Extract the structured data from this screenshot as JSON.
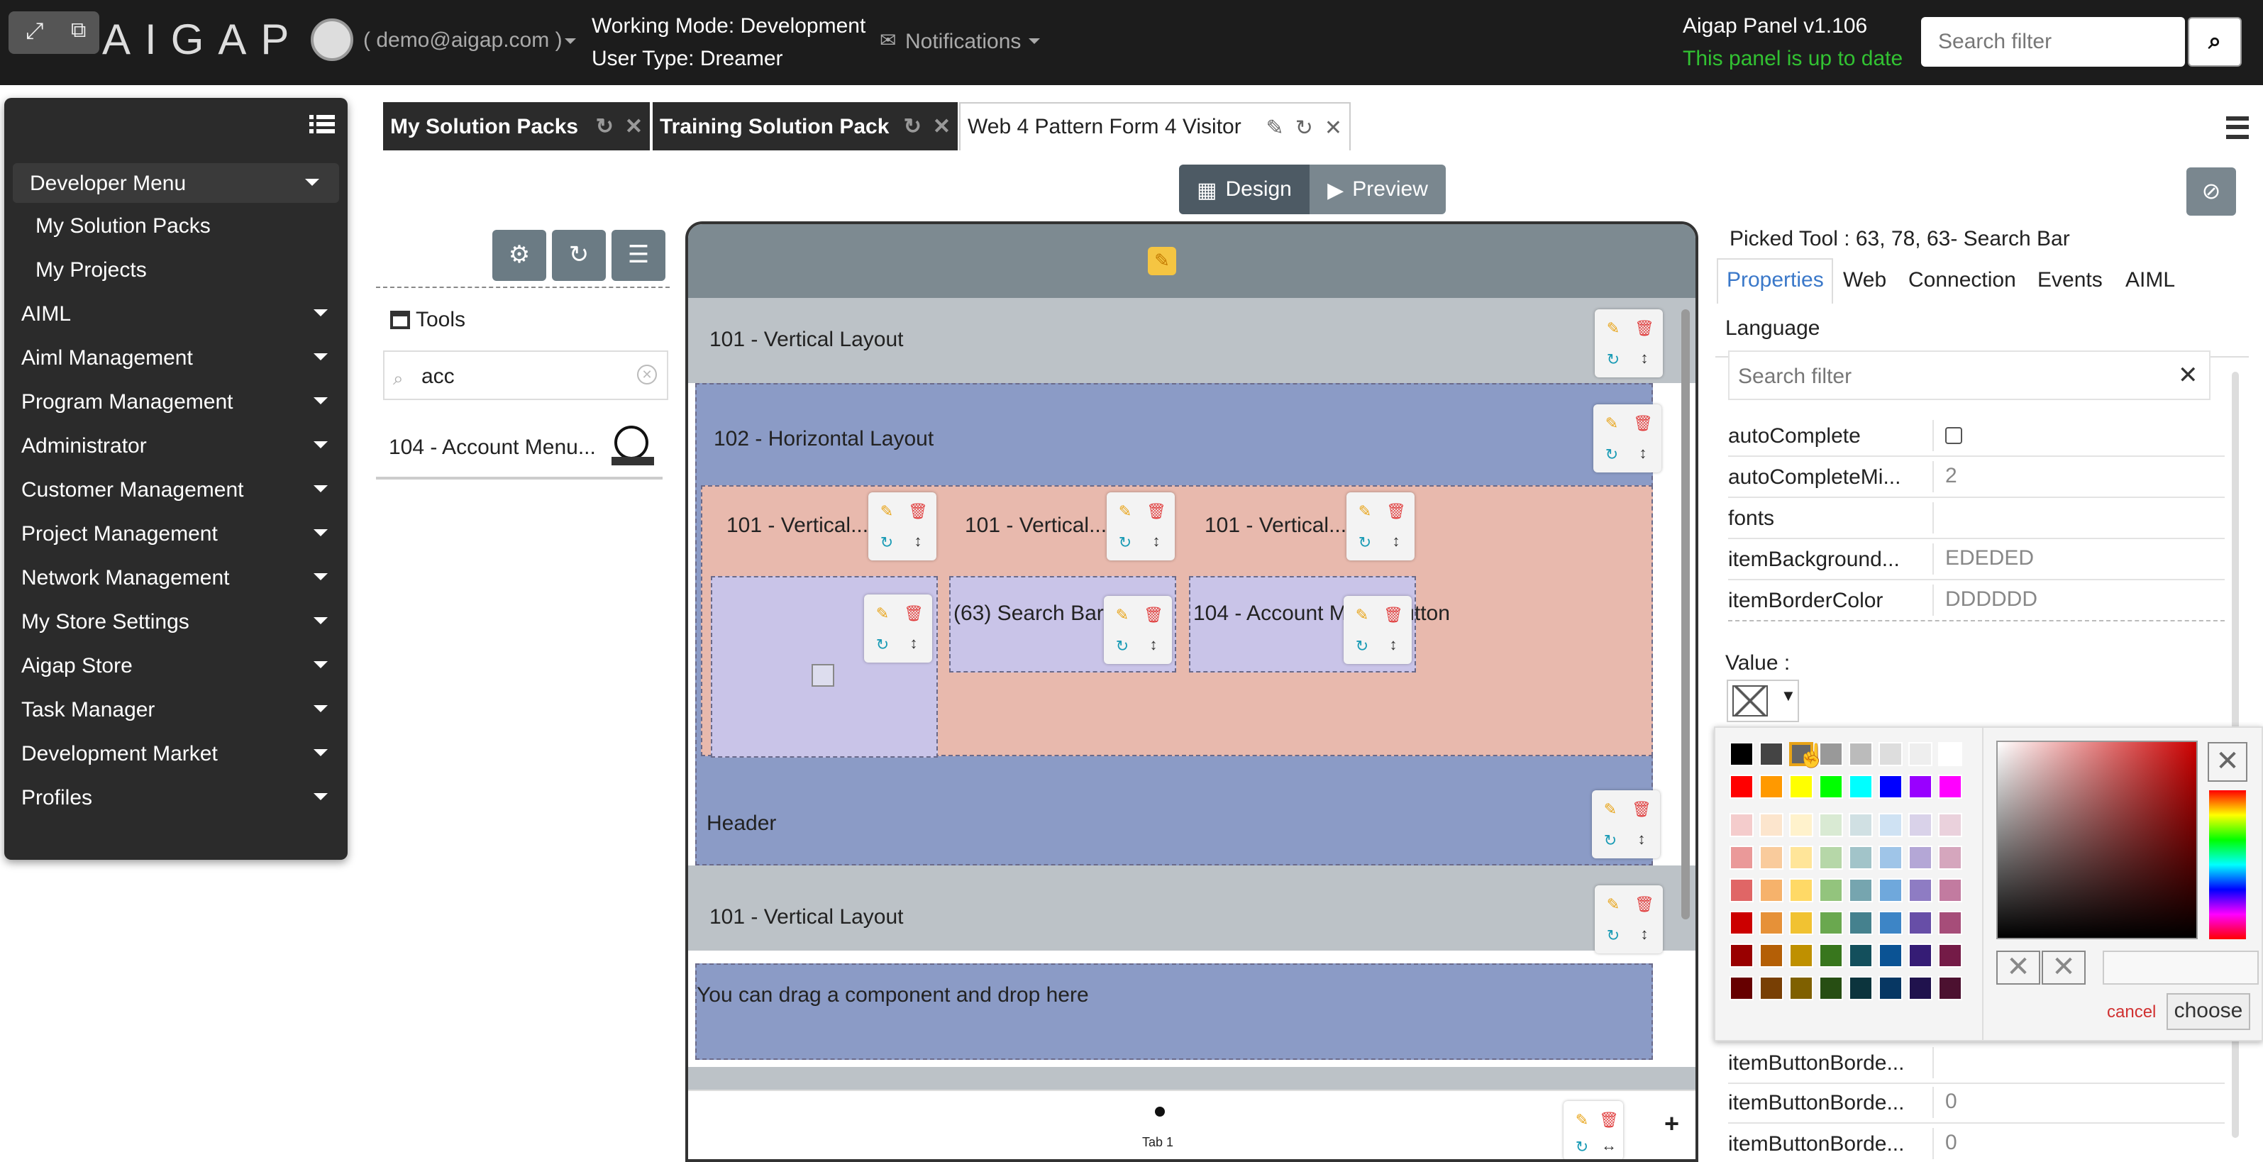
{
  "app": {
    "logo_text": "AIGAP",
    "user": "( demo@aigap.com )",
    "working_mode": "Working Mode: Development",
    "user_type": "User Type: Dreamer",
    "notifications": "Notifications",
    "panel_version": "Aigap Panel v1.106",
    "panel_status": "This panel is up to date",
    "search_placeholder": "Search filter"
  },
  "sidebar": {
    "items": [
      {
        "label": "Developer Menu",
        "type": "header"
      },
      {
        "label": "My Solution Packs",
        "type": "sub"
      },
      {
        "label": "My Projects",
        "type": "sub"
      },
      {
        "label": "AIML",
        "type": "menu"
      },
      {
        "label": "Aiml Management",
        "type": "menu"
      },
      {
        "label": "Program Management",
        "type": "menu"
      },
      {
        "label": "Administrator",
        "type": "menu"
      },
      {
        "label": "Customer Management",
        "type": "menu"
      },
      {
        "label": "Project Management",
        "type": "menu"
      },
      {
        "label": "Network Management",
        "type": "menu"
      },
      {
        "label": "My Store Settings",
        "type": "menu"
      },
      {
        "label": "Aigap Store",
        "type": "menu"
      },
      {
        "label": "Task Manager",
        "type": "menu"
      },
      {
        "label": "Development Market",
        "type": "menu"
      },
      {
        "label": "Profiles",
        "type": "menu"
      }
    ]
  },
  "tabs": [
    {
      "label": "My Solution Packs"
    },
    {
      "label": "Training Solution Pack"
    },
    {
      "label": "Web 4 Pattern Form 4 Visitor"
    }
  ],
  "mode": {
    "design": "Design",
    "preview": "Preview"
  },
  "tools": {
    "title": "Tools",
    "search_value": "acc",
    "items": [
      {
        "label": "104 - Account Menu..."
      }
    ]
  },
  "canvas": {
    "blocks": {
      "v1": "101 - Vertical Layout",
      "h1": "102 - Horizontal Layout",
      "vc1": "101 - Vertical...",
      "vc2": "101 - Vertical...",
      "vc3": "101 - Vertical...",
      "search": "(63) Search Bar",
      "account": "104 - Account Menu Button",
      "header": "Header",
      "v2": "101 - Vertical Layout",
      "drop": "You can drag a component and drop here",
      "tab": "Tab 1",
      "add": "+"
    }
  },
  "properties": {
    "picked": "Picked Tool : 63, 78, 63- Search Bar",
    "tabs": [
      "Properties",
      "Web",
      "Connection",
      "Events",
      "AIML"
    ],
    "language": "Language",
    "search_placeholder": "Search filter",
    "rows": [
      {
        "key": "autoComplete",
        "value": ""
      },
      {
        "key": "autoCompleteMi...",
        "value": "2"
      },
      {
        "key": "fonts",
        "value": ""
      },
      {
        "key": "itemBackground...",
        "value": "EDEDED"
      },
      {
        "key": "itemBorderColor",
        "value": "DDDDDD"
      }
    ],
    "value_label": "Value :",
    "rows_bottom": [
      {
        "key": "itemButtonBorde...",
        "value": ""
      },
      {
        "key": "itemButtonBorde...",
        "value": "0"
      },
      {
        "key": "itemButtonBorde...",
        "value": "0"
      }
    ]
  },
  "color_picker": {
    "cancel": "cancel",
    "choose": "choose",
    "accent": "#cc0000"
  },
  "colors": {
    "topbar": "#1c1c1c",
    "status_green": "#32c232",
    "layout_gray": "#bcc2c7",
    "layout_blue": "#8b9bc6",
    "layout_salmon": "#e8b9ad",
    "layout_lilac": "#c9c4e8"
  }
}
